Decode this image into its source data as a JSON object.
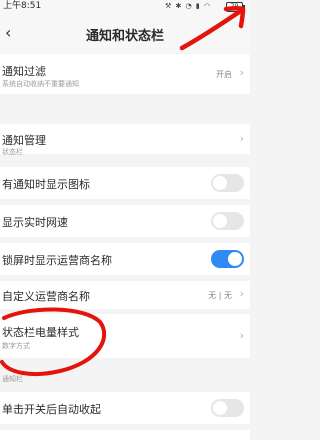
{
  "status_bar": {
    "time": "上午8:51",
    "battery": "79"
  },
  "header": {
    "title": "通知和状态栏"
  },
  "rows": {
    "notification_filter": {
      "label": "通知过滤",
      "sub": "系统自动收纳不重要通知",
      "value": "开启"
    },
    "notification_manage": {
      "label": "通知管理"
    },
    "section_status_bar": "状态栏",
    "show_notification_icons": {
      "label": "有通知时显示图标",
      "enabled": false
    },
    "show_network_speed": {
      "label": "显示实时网速",
      "enabled": false
    },
    "lockscreen_carrier": {
      "label": "锁屏时显示运营商名称",
      "enabled": true
    },
    "custom_carrier": {
      "label": "自定义运营商名称",
      "value": "无 | 无"
    },
    "battery_style": {
      "label": "状态栏电量样式",
      "sub": "数字方式"
    },
    "section_notification_bar": "通知栏",
    "auto_collapse": {
      "label": "单击开关后自动收起",
      "enabled": false
    }
  },
  "annotation_color": "#e3140c"
}
